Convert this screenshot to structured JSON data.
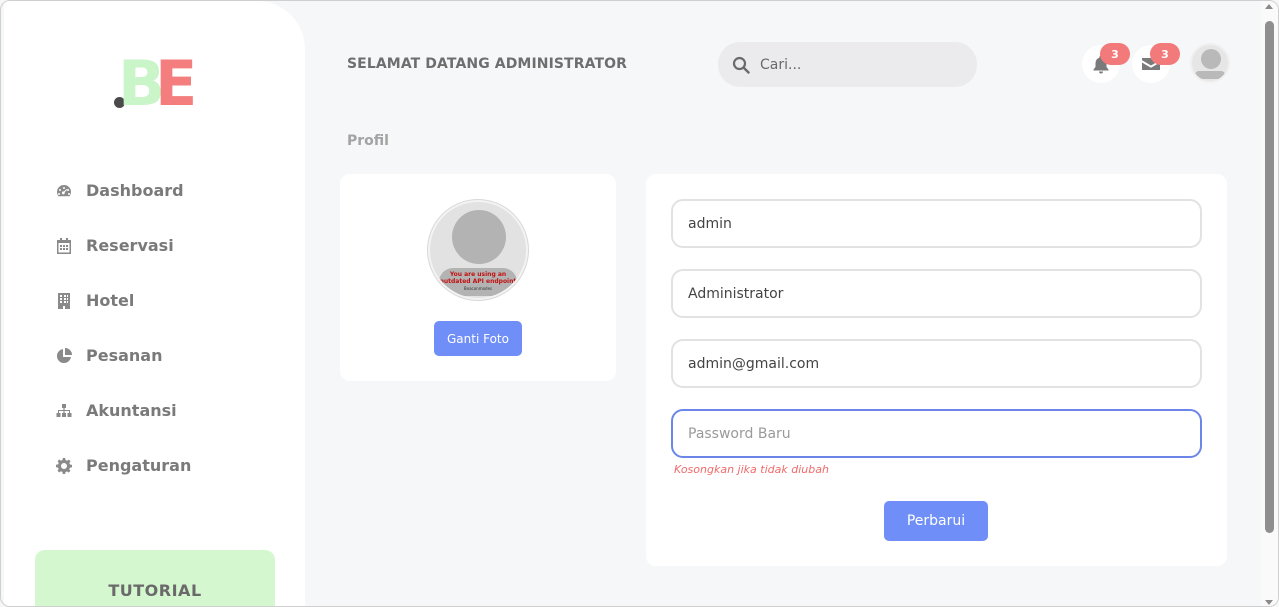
{
  "logo": {
    "part1": "B",
    "part2": "E"
  },
  "sidebar": {
    "items": [
      {
        "label": "Dashboard",
        "icon": "dashboard-icon"
      },
      {
        "label": "Reservasi",
        "icon": "calendar-icon"
      },
      {
        "label": "Hotel",
        "icon": "building-icon"
      },
      {
        "label": "Pesanan",
        "icon": "pie-chart-icon"
      },
      {
        "label": "Akuntansi",
        "icon": "sitemap-icon"
      },
      {
        "label": "Pengaturan",
        "icon": "gear-icon"
      }
    ],
    "tutorial_label": "TUTORIAL"
  },
  "header": {
    "welcome": "SELAMAT DATANG ADMINISTRATOR",
    "search_placeholder": "Cari...",
    "notifications_count": "3",
    "messages_count": "3"
  },
  "breadcrumb": "Profil",
  "photo_card": {
    "avatar_warning": "You are using an outdated API endpoint",
    "avatar_sub": "Beaconmodes",
    "change_photo_label": "Ganti Foto"
  },
  "form": {
    "username": "admin",
    "name": "Administrator",
    "email": "admin@gmail.com",
    "password_placeholder": "Password Baru",
    "password_hint": "Kosongkan jika tidak diubah",
    "submit_label": "Perbarui"
  },
  "colors": {
    "accent": "#6f8ef7",
    "logo_green": "#c9f5c8",
    "logo_red": "#f47d7d",
    "badge": "#f27a7a",
    "tutorial_bg": "#d4f7cf"
  }
}
